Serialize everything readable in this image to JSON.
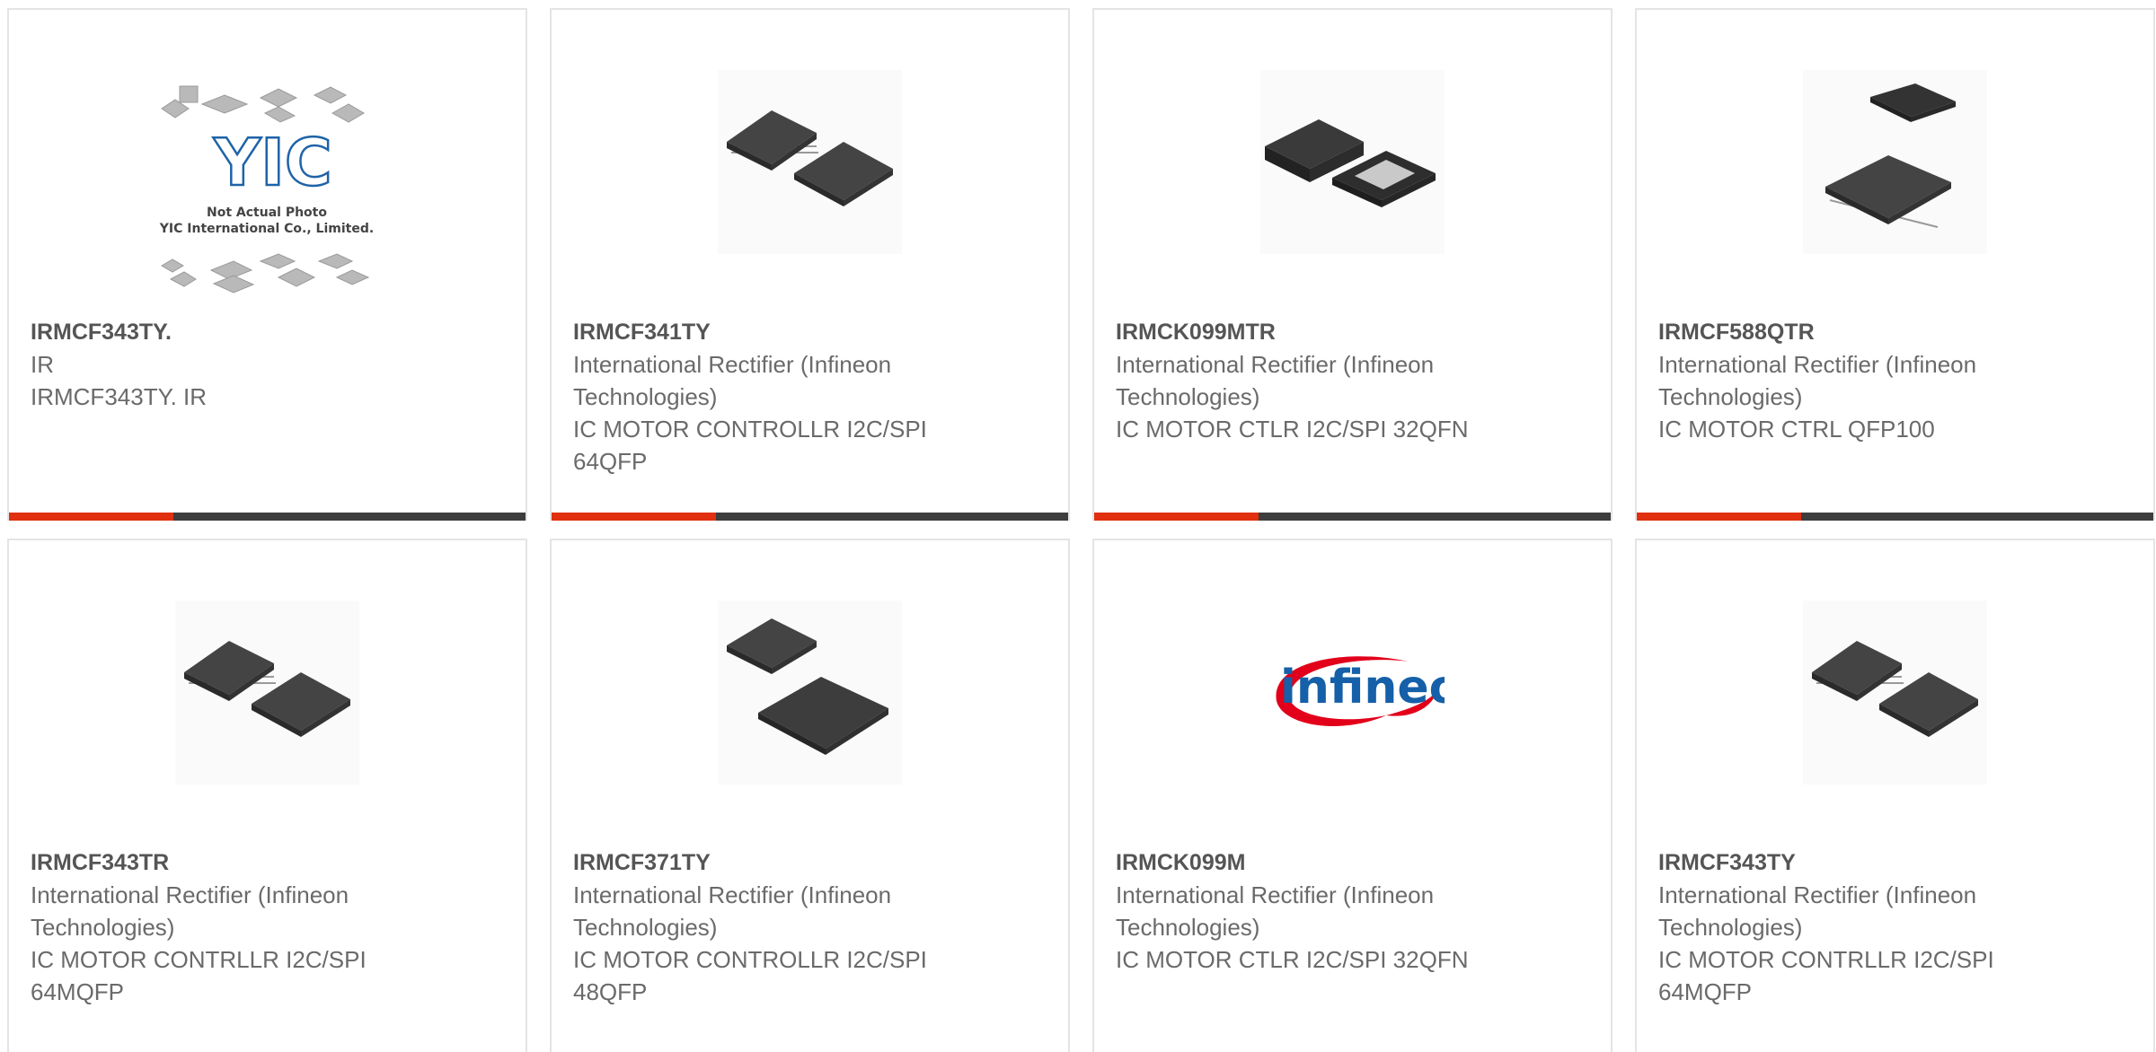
{
  "products": [
    {
      "part": "IRMCF343TY.",
      "maker": "IR",
      "desc": "IRMCF343TY. IR",
      "image": "placeholder-photo",
      "placeholder_line1": "Not Actual Photo",
      "placeholder_line2": "YIC International Co., Limited.",
      "placeholder_logo": "YIC"
    },
    {
      "part": "IRMCF341TY",
      "maker": "International Rectifier (Infineon Technologies)",
      "desc": "IC MOTOR CONTROLLR I2C/SPI 64QFP",
      "image": "two-qfp-chips"
    },
    {
      "part": "IRMCK099MTR",
      "maker": "International Rectifier (Infineon Technologies)",
      "desc": "IC MOTOR CTLR I2C/SPI 32QFN",
      "image": "two-qfn-chips"
    },
    {
      "part": "IRMCF588QTR",
      "maker": "International Rectifier (Infineon Technologies)",
      "desc": "IC MOTOR CTRL QFP100",
      "image": "two-qfp-chips-stacked"
    },
    {
      "part": "IRMCF343TR",
      "maker": "International Rectifier (Infineon Technologies)",
      "desc": "IC MOTOR CONTRLLR I2C/SPI 64MQFP",
      "image": "two-qfp-chips"
    },
    {
      "part": "IRMCF371TY",
      "maker": "International Rectifier (Infineon Technologies)",
      "desc": "IC MOTOR CONTROLLR I2C/SPI 48QFP",
      "image": "two-qfp-chips-diagonal"
    },
    {
      "part": "IRMCK099M",
      "maker": "International Rectifier (Infineon Technologies)",
      "desc": "IC MOTOR CTLR I2C/SPI 32QFN",
      "image": "infineon-logo",
      "logo_text": "infineon"
    },
    {
      "part": "IRMCF343TY",
      "maker": "International Rectifier (Infineon Technologies)",
      "desc": "IC MOTOR CONTRLLR I2C/SPI 64MQFP",
      "image": "two-qfp-chips"
    }
  ],
  "colors": {
    "accent": "#e0300f",
    "bar": "#3d3d3d",
    "infineon_red": "#e2001a",
    "infineon_blue": "#1560a8"
  }
}
